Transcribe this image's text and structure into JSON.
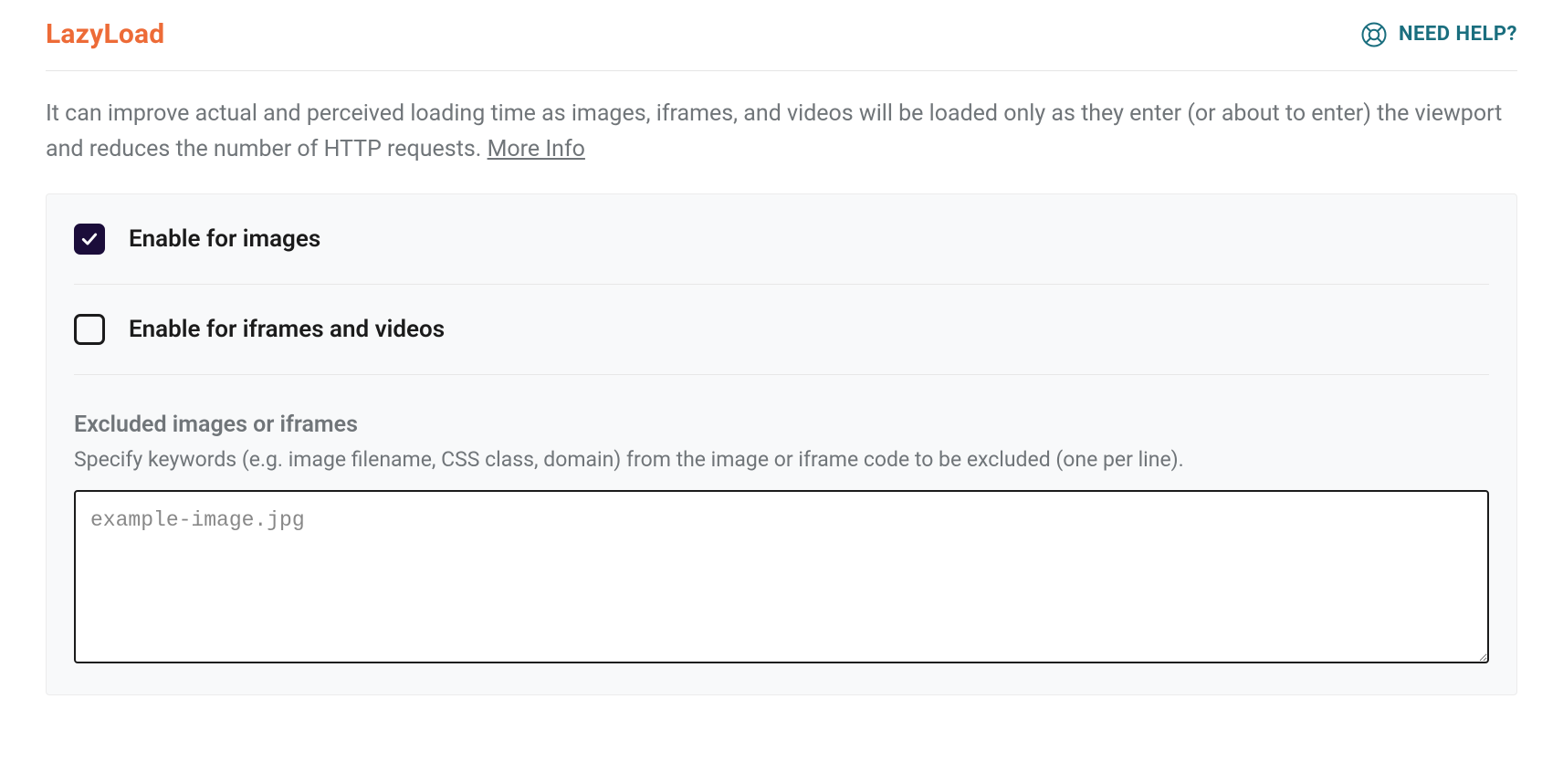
{
  "section": {
    "title": "LazyLoad",
    "help_label": "NEED HELP?",
    "description": "It can improve actual and perceived loading time as images, iframes, and videos will be loaded only as they enter (or about to enter) the viewport and reduces the number of HTTP requests. ",
    "more_info_label": "More Info"
  },
  "options": {
    "enable_images": {
      "label": "Enable for images",
      "checked": true
    },
    "enable_iframes": {
      "label": "Enable for iframes and videos",
      "checked": false
    }
  },
  "excluded": {
    "title": "Excluded images or iframes",
    "description": "Specify keywords (e.g. image filename, CSS class, domain) from the image or iframe code to be excluded (one per line).",
    "placeholder": "example-image.jpg",
    "value": ""
  },
  "colors": {
    "accent": "#ED6B37",
    "help": "#1A6E7E",
    "checkbox_checked": "#1b0d3a"
  }
}
